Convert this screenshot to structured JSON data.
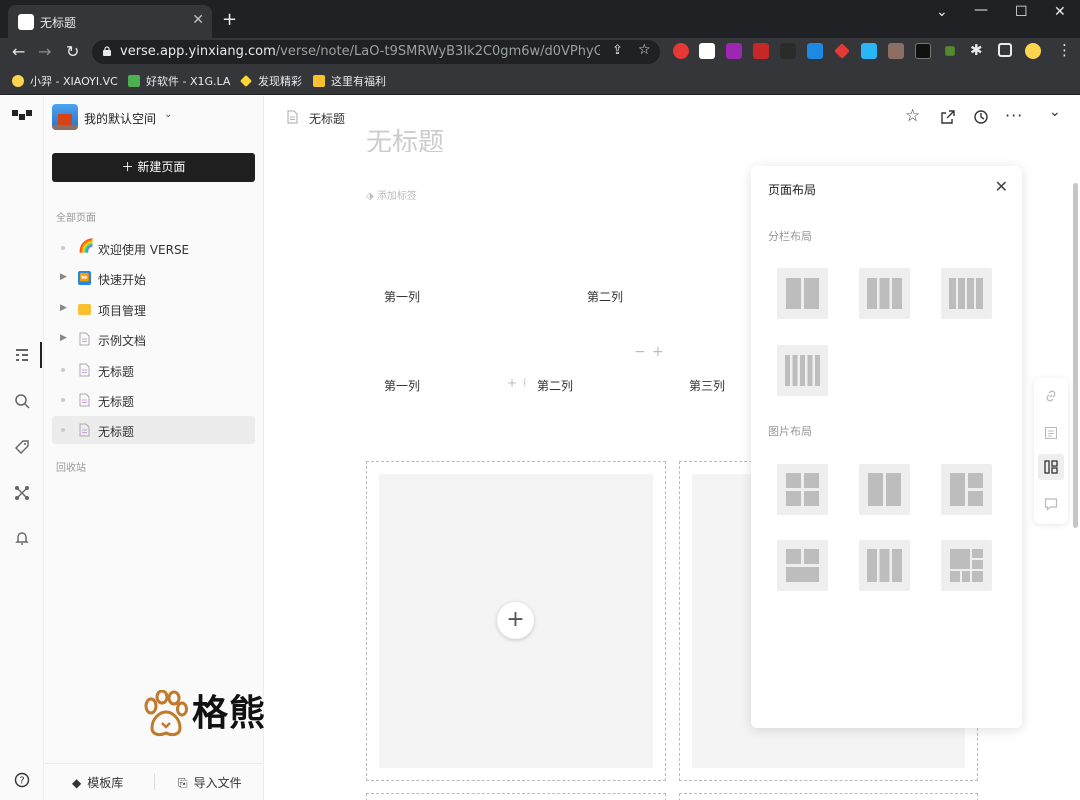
{
  "browser": {
    "tab_title": "无标题",
    "url_domain": "verse.app.yinxiang.com",
    "url_path": "/verse/note/LaO-t9SMRWyB3Ik2C0gm6w/d0VPhyGoTmytIj...",
    "bookmarks": [
      "小羿 - XIAOYI.VC",
      "好软件 - X1G.LA",
      "发现精彩",
      "这里有福利"
    ]
  },
  "sidebar": {
    "workspace": "我的默认空间",
    "new_page": "新建页面",
    "section_all": "全部页面",
    "items": [
      {
        "label": "欢迎使用 VERSE",
        "icon": "rainbow-icon"
      },
      {
        "label": "快速开始",
        "icon": "fast-forward-icon"
      },
      {
        "label": "项目管理",
        "icon": "folder-icon"
      },
      {
        "label": "示例文档",
        "icon": "document-icon"
      },
      {
        "label": "无标题",
        "icon": "document-icon"
      },
      {
        "label": "无标题",
        "icon": "document-icon"
      },
      {
        "label": "无标题",
        "icon": "document-icon"
      }
    ],
    "trash": "回收站",
    "templates": "模板库",
    "import": "导入文件"
  },
  "doc": {
    "header_title": "无标题",
    "big_title": "无标题",
    "add_tag": "添加标签",
    "row1": [
      "第一列",
      "第二列"
    ],
    "row2": [
      "第一列",
      "第二列",
      "第三列"
    ]
  },
  "panel": {
    "title": "页面布局",
    "section_columns": "分栏布局",
    "section_images": "图片布局"
  },
  "watermark": "格熊"
}
